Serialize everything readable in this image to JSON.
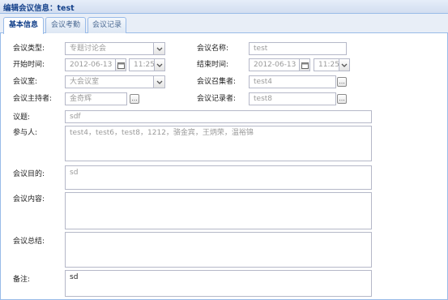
{
  "window": {
    "title": "编辑会议信息：test"
  },
  "tabs": [
    {
      "label": "基本信息"
    },
    {
      "label": "会议考勤"
    },
    {
      "label": "会议记录"
    }
  ],
  "form": {
    "meeting_type": {
      "label": "会议类型:",
      "value": "专题讨论会"
    },
    "meeting_name": {
      "label": "会议名称:",
      "value": "test"
    },
    "start_time": {
      "label": "开始时间:",
      "date": "2012-06-13",
      "time": "11:25"
    },
    "end_time": {
      "label": "结束时间:",
      "date": "2012-06-13",
      "time": "11:25"
    },
    "meeting_room": {
      "label": "会议室:",
      "value": "大会议室"
    },
    "convener": {
      "label": "会议召集者:",
      "value": "test4"
    },
    "host": {
      "label": "会议主持者:",
      "value": "金奇辉"
    },
    "recorder": {
      "label": "会议记录者:",
      "value": "test8"
    },
    "topic": {
      "label": "议题:",
      "value": "sdf"
    },
    "participants": {
      "label": "参与人:",
      "value": "test4，test6，test8，1212，骆金宾，王炳荣，温裕锦"
    },
    "purpose": {
      "label": "会议目的:",
      "value": "sd"
    },
    "content": {
      "label": "会议内容:",
      "value": ""
    },
    "summary": {
      "label": "会议总结:",
      "value": ""
    },
    "remarks": {
      "label": "备注:",
      "value": "sd"
    }
  },
  "buttons": {
    "lookup": "..."
  },
  "icons": {
    "dropdown": "chevron-down-icon",
    "calendar": "calendar-icon"
  },
  "colors": {
    "header_text": "#15428b",
    "border": "#99bbe8",
    "field_border": "#b5b8c8"
  }
}
